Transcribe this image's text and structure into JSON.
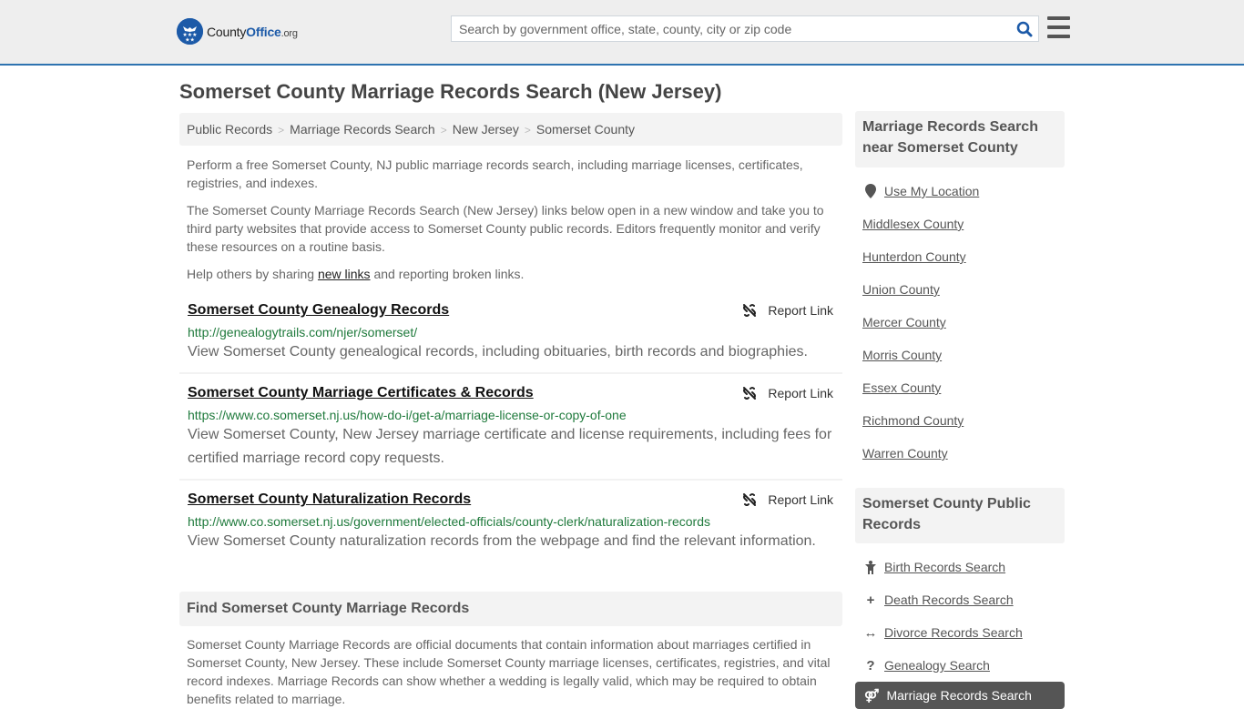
{
  "header": {
    "logo": {
      "county": "County",
      "office": "Office",
      "org": ".org"
    },
    "search_placeholder": "Search by government office, state, county, city or zip code",
    "search_value": ""
  },
  "page": {
    "title": "Somerset County Marriage Records Search (New Jersey)",
    "breadcrumb": [
      "Public Records",
      "Marriage Records Search",
      "New Jersey",
      "Somerset County"
    ],
    "intro": [
      "Perform a free Somerset County, NJ public marriage records search, including marriage licenses, certificates, registries, and indexes.",
      "The Somerset County Marriage Records Search (New Jersey) links below open in a new window and take you to third party websites that provide access to Somerset County public records. Editors frequently monitor and verify these resources on a routine basis."
    ],
    "help": {
      "before": "Help others by sharing ",
      "link": "new links",
      "after": " and reporting broken links."
    }
  },
  "results": [
    {
      "title": "Somerset County Genealogy Records",
      "url": "http://genealogytrails.com/njer/somerset/",
      "desc": "View Somerset County genealogical records, including obituaries, birth records and biographies.",
      "report": "Report Link"
    },
    {
      "title": "Somerset County Marriage Certificates & Records",
      "url": "https://www.co.somerset.nj.us/how-do-i/get-a/marriage-license-or-copy-of-one",
      "desc": "View Somerset County, New Jersey marriage certificate and license requirements, including fees for certified marriage record copy requests.",
      "report": "Report Link"
    },
    {
      "title": "Somerset County Naturalization Records",
      "url": "http://www.co.somerset.nj.us/government/elected-officials/county-clerk/naturalization-records",
      "desc": "View Somerset County naturalization records from the webpage and find the relevant information.",
      "report": "Report Link"
    }
  ],
  "find": {
    "heading": "Find Somerset County Marriage Records",
    "text": "Somerset County Marriage Records are official documents that contain information about marriages certified in Somerset County, New Jersey. These include Somerset County marriage licenses, certificates, registries, and vital record indexes. Marriage Records can show whether a wedding is legally valid, which may be required to obtain benefits related to marriage."
  },
  "sidebar": {
    "nearby_heading": "Marriage Records Search near Somerset County",
    "use_location": "Use My Location",
    "nearby": [
      "Middlesex County",
      "Hunterdon County",
      "Union County",
      "Mercer County",
      "Morris County",
      "Essex County",
      "Richmond County",
      "Warren County"
    ],
    "public_heading": "Somerset County Public Records",
    "public": [
      {
        "label": "Birth Records Search",
        "icon": "child-icon"
      },
      {
        "label": "Death Records Search",
        "icon": "plus-icon"
      },
      {
        "label": "Divorce Records Search",
        "icon": "arrows-h-icon"
      },
      {
        "label": "Genealogy Search",
        "icon": "question-icon"
      }
    ],
    "active": {
      "label": "Marriage Records Search",
      "icon": "marriage-icon"
    }
  },
  "colors": {
    "brand": "#1c5aa8",
    "url_green": "#1f7a3c",
    "header_border": "#2e73b0"
  }
}
